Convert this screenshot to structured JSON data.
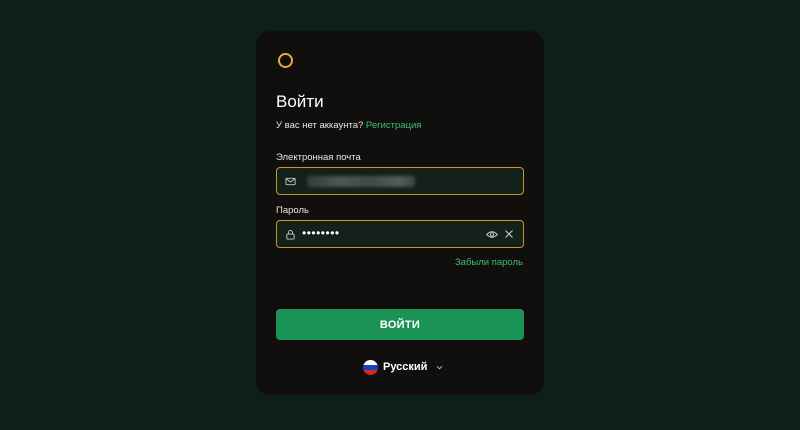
{
  "login": {
    "title": "Войти",
    "no_account_text": "У вас нет аккаунта?",
    "signup_link": "Регистрация",
    "email_label": "Электронная почта",
    "password_label": "Пароль",
    "password_masked": "••••••••",
    "forgot_password": "Забыли пароль",
    "submit_label": "ВОЙТИ"
  },
  "language": {
    "selected": "Русский",
    "flag_colors": [
      "#ffffff",
      "#1c3fbf",
      "#d52b1e"
    ]
  },
  "icons": {
    "logo": "ring-logo-icon",
    "email": "mail-icon",
    "password": "lock-icon",
    "show_password": "eye-icon",
    "clear": "close-icon",
    "dropdown": "chevron-down-icon"
  },
  "colors": {
    "background": "#0c2018",
    "card": "#100f0d",
    "accent_green": "#3fbf6e",
    "button_green": "#1c9356",
    "field_border": "#c8942c",
    "logo_ring": "#e8a93a"
  }
}
